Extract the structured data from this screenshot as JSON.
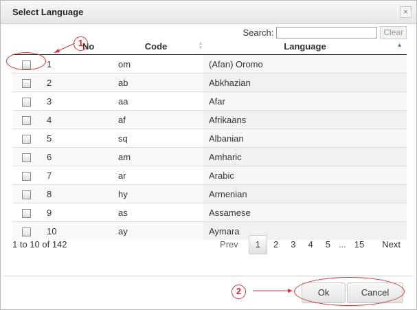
{
  "dialog": {
    "title": "Select Language",
    "close_glyph": "×"
  },
  "search": {
    "label": "Search:",
    "value": "",
    "placeholder": "",
    "clear_label": "Clear"
  },
  "table": {
    "headers": {
      "no": "No",
      "code": "Code",
      "language": "Language"
    },
    "rows": [
      {
        "no": "1",
        "code": "om",
        "language": "(Afan) Oromo"
      },
      {
        "no": "2",
        "code": "ab",
        "language": "Abkhazian"
      },
      {
        "no": "3",
        "code": "aa",
        "language": "Afar"
      },
      {
        "no": "4",
        "code": "af",
        "language": "Afrikaans"
      },
      {
        "no": "5",
        "code": "sq",
        "language": "Albanian"
      },
      {
        "no": "6",
        "code": "am",
        "language": "Amharic"
      },
      {
        "no": "7",
        "code": "ar",
        "language": "Arabic"
      },
      {
        "no": "8",
        "code": "hy",
        "language": "Armenian"
      },
      {
        "no": "9",
        "code": "as",
        "language": "Assamese"
      },
      {
        "no": "10",
        "code": "ay",
        "language": "Aymara"
      }
    ]
  },
  "footer": {
    "info": "1 to 10 of 142",
    "pager": {
      "prev": "Prev",
      "pages": [
        "1",
        "2",
        "3",
        "4",
        "5"
      ],
      "ellipsis": "...",
      "last": "15",
      "next": "Next",
      "current": "1"
    }
  },
  "buttons": {
    "ok": "Ok",
    "cancel": "Cancel"
  },
  "annotations": {
    "one": "1",
    "two": "2",
    "color": "#d33333"
  }
}
